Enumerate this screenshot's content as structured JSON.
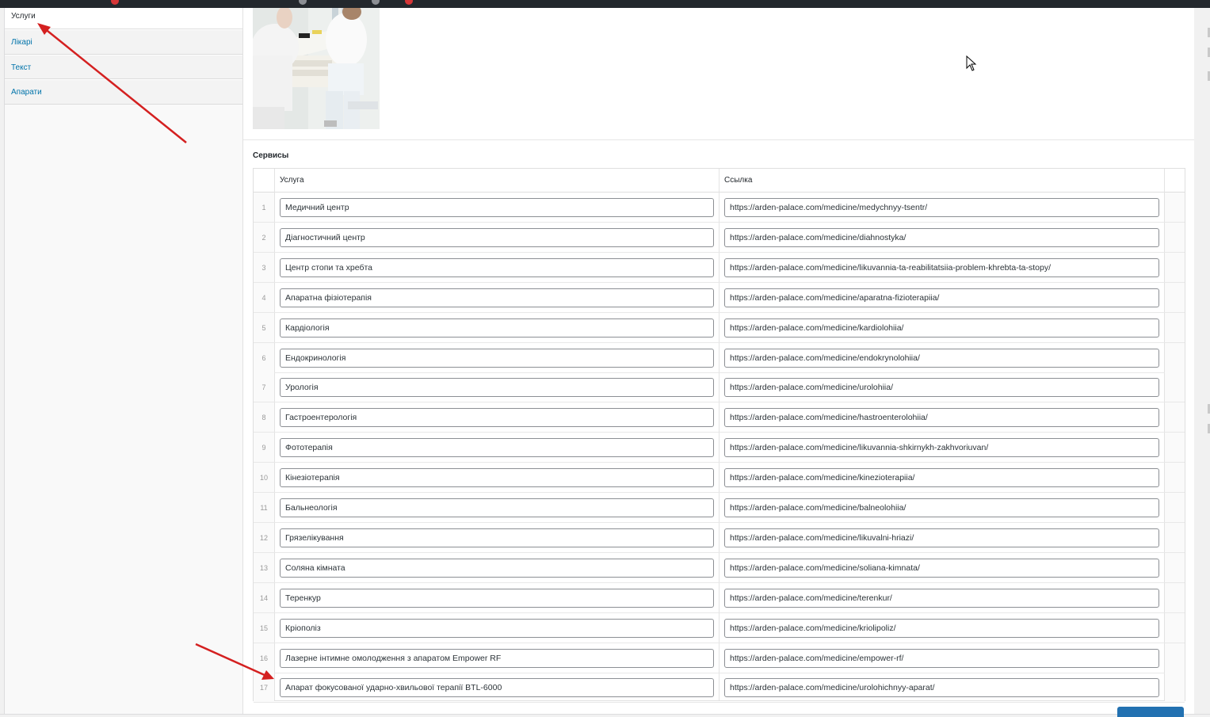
{
  "tabs": [
    {
      "label": "Услуги",
      "active": true
    },
    {
      "label": "Лікарі",
      "active": false
    },
    {
      "label": "Текст",
      "active": false
    },
    {
      "label": "Апарати",
      "active": false
    }
  ],
  "section": {
    "label": "Сервисы"
  },
  "table": {
    "headers": {
      "service": "Услуга",
      "link": "Ссылка"
    },
    "rows": [
      {
        "num": "1",
        "service": "Медичний центр",
        "link": "https://arden-palace.com/medicine/medychnyy-tsentr/"
      },
      {
        "num": "2",
        "service": "Діагностичний центр",
        "link": "https://arden-palace.com/medicine/diahnostyka/"
      },
      {
        "num": "3",
        "service": "Центр стопи та хребта",
        "link": "https://arden-palace.com/medicine/likuvannia-ta-reabilitatsiia-problem-khrebta-ta-stopy/"
      },
      {
        "num": "4",
        "service": "Апаратна фізіотерапія",
        "link": "https://arden-palace.com/medicine/aparatna-fizioterapiia/"
      },
      {
        "num": "5",
        "service": "Кардіологія",
        "link": "https://arden-palace.com/medicine/kardiolohiia/"
      },
      {
        "num": "6",
        "service": "Ендокринологія",
        "link": "https://arden-palace.com/medicine/endokrynolohiia/"
      },
      {
        "num": "7",
        "service": "Урологія",
        "link": "https://arden-palace.com/medicine/urolohiia/"
      },
      {
        "num": "8",
        "service": "Гастроентерологія",
        "link": "https://arden-palace.com/medicine/hastroenterolohiia/"
      },
      {
        "num": "9",
        "service": "Фототерапія",
        "link": "https://arden-palace.com/medicine/likuvannia-shkirnykh-zakhvoriuvan/"
      },
      {
        "num": "10",
        "service": "Кінезіотерапія",
        "link": "https://arden-palace.com/medicine/kinezioterapiia/"
      },
      {
        "num": "11",
        "service": "Бальнеологія",
        "link": "https://arden-palace.com/medicine/balneolohiia/"
      },
      {
        "num": "12",
        "service": "Грязелікування",
        "link": "https://arden-palace.com/medicine/likuvalni-hriazi/"
      },
      {
        "num": "13",
        "service": "Соляна кімната",
        "link": "https://arden-palace.com/medicine/soliana-kimnata/"
      },
      {
        "num": "14",
        "service": "Теренкур",
        "link": "https://arden-palace.com/medicine/terenkur/"
      },
      {
        "num": "15",
        "service": "Кріополіз",
        "link": "https://arden-palace.com/medicine/kriolipoliz/"
      },
      {
        "num": "16",
        "service": "Лазерне інтимне омолодження з апаратом Empower RF",
        "link": "https://arden-palace.com/medicine/empower-rf/"
      },
      {
        "num": "17",
        "service": "Апарат фокусованої ударно-хвильової терапії BTL-6000",
        "link": "https://arden-palace.com/medicine/urolohichnyy-aparat/"
      }
    ]
  },
  "colors": {
    "accent": "#2271b1",
    "link": "#0073aa",
    "annotation_arrow": "#d42020",
    "admin_bar": "#23282d"
  },
  "icons": {
    "cursor": "mouse-pointer-icon",
    "annotation": "red-arrow-annotation"
  }
}
